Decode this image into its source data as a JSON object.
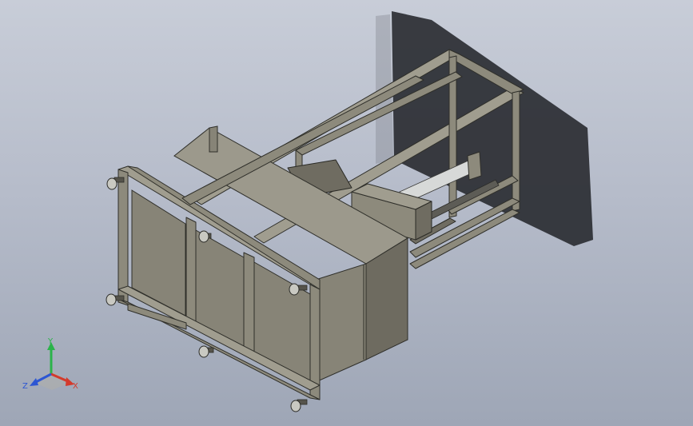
{
  "view": {
    "background_top": "#c8cdd8",
    "background_bottom": "#9ea6b6",
    "frame_color": "#8d8a7c"
  },
  "triad": {
    "y_label": "Y",
    "z_label": "Z",
    "x_label": "X",
    "y_color": "#2bb34a",
    "x_color": "#d33a2c",
    "z_color": "#2c56d3"
  }
}
